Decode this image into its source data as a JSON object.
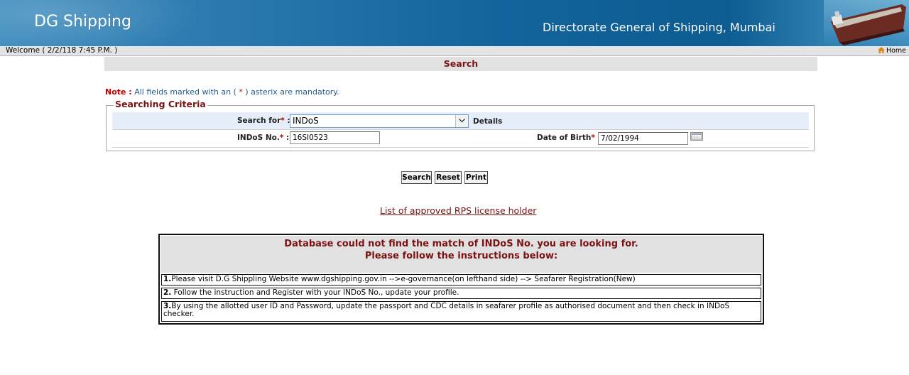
{
  "header": {
    "site_title": "DG Shipping",
    "org_name": "Directorate General of Shipping, Mumbai"
  },
  "welcome_bar": {
    "welcome_text": "Welcome ( 2/2/118 7:45 P.M. )",
    "home_label": "Home"
  },
  "page": {
    "title": "Search",
    "note_label": "Note :",
    "note_text_1": "All fields marked with an (",
    "note_asterisk": "*",
    "note_text_2": ") asterix are mandatory."
  },
  "criteria": {
    "legend": "Searching Criteria",
    "search_for_label": "Search for",
    "search_for_value": "INDoS",
    "details_label": "Details",
    "indos_label": "INDoS No.",
    "indos_value": "16SI0523",
    "dob_label": "Date of Birth",
    "dob_value": "7/02/1994",
    "asterisk": "*",
    "colon": ":"
  },
  "buttons": {
    "search": "Search",
    "reset": "Reset",
    "print": "Print"
  },
  "rps_link": "List of approved RPS license holder",
  "message": {
    "line1": "Database could not find the match of INDoS No. you are looking for.",
    "line2": "Please follow the instructions below:",
    "steps": [
      {
        "num": "1.",
        "text": "Please visit D.G Shippling Website www.dgshipping.gov.in -->e-governance(on lefthand side) --> Seafarer Registration(New)"
      },
      {
        "num": "2.",
        "text": " Follow the instruction and Register with your INDoS No., update your profile."
      },
      {
        "num": "3.",
        "text": "By using the allotted user ID and Password, update the passport and CDC details in seafarer profile as authorised document and then check in INDoS checker."
      }
    ]
  },
  "colors": {
    "banner_blue": "#13649c",
    "heading_maroon": "#7a1212",
    "note_blue": "#1d5b8e",
    "required_red": "#c00000"
  },
  "icons": [
    "home-icon",
    "ship-image",
    "calendar-icon",
    "chevron-down-icon"
  ]
}
